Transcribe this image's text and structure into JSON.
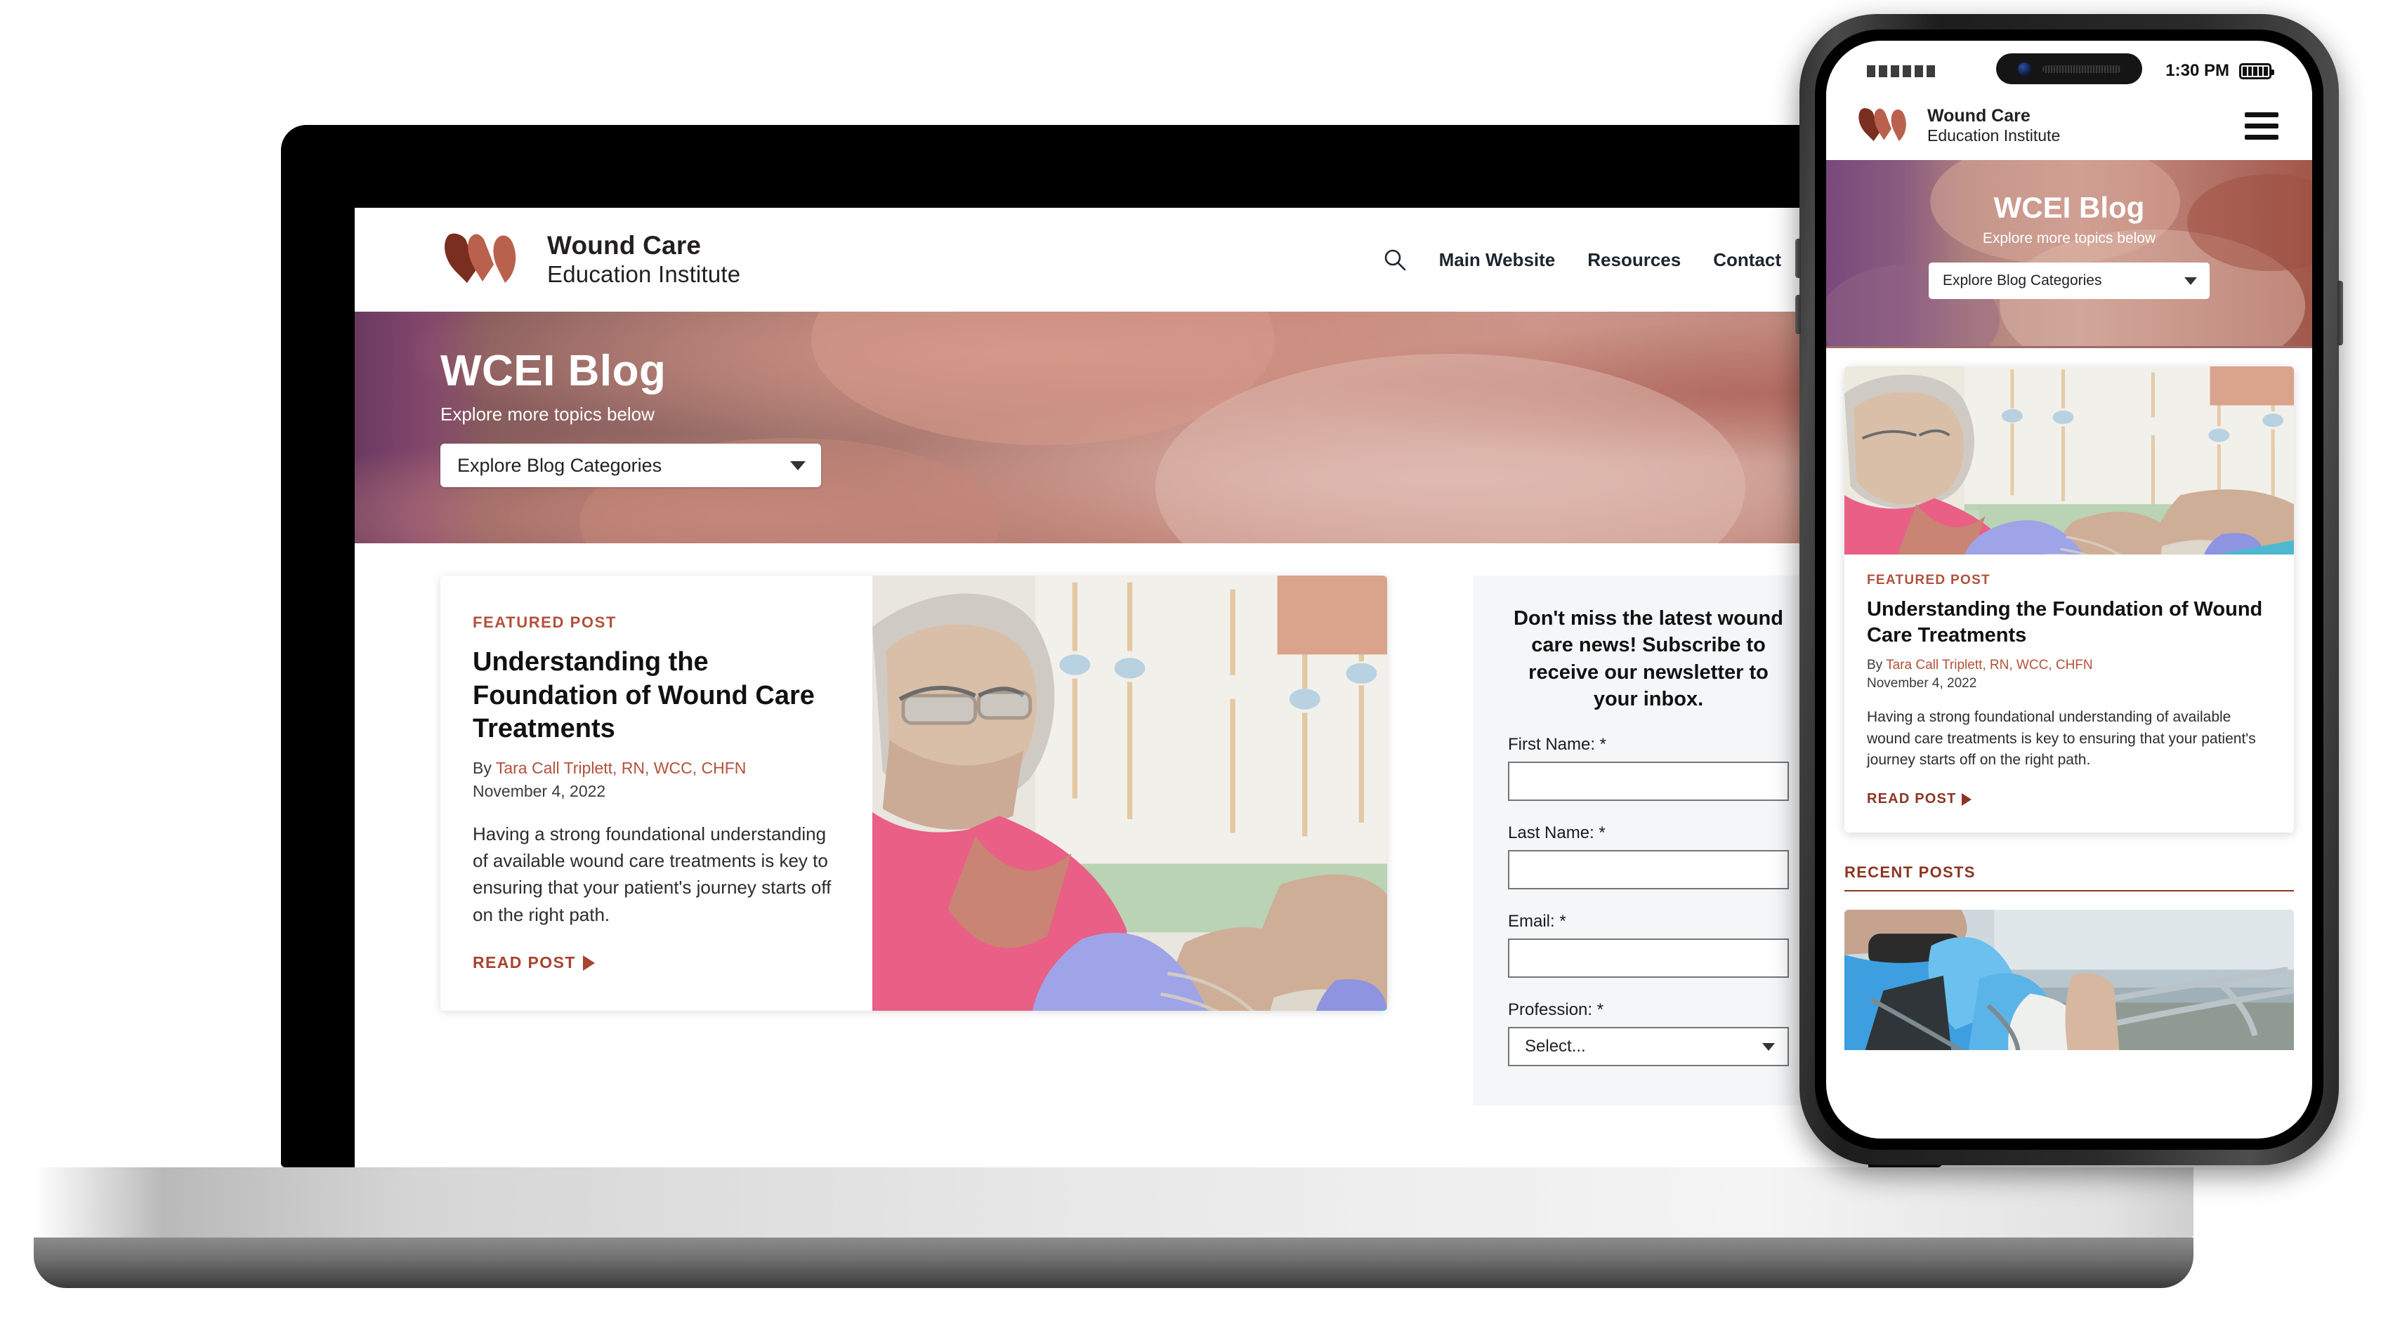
{
  "brand": {
    "logo_line1": "Wound Care",
    "logo_line2": "Education Institute",
    "accent": "#b2513c",
    "accent_dark": "#8c3523",
    "logo_dark": "#7a2e20",
    "logo_light": "#b9614d"
  },
  "desktop": {
    "nav": {
      "search_icon": "search-icon",
      "links": [
        {
          "label": "Main Website"
        },
        {
          "label": "Resources"
        },
        {
          "label": "Contact"
        }
      ]
    },
    "hero": {
      "title": "WCEI Blog",
      "subtitle": "Explore more topics below",
      "category_select": {
        "value": "Explore Blog Categories",
        "icon": "chevron-down-icon"
      }
    },
    "featured": {
      "eyebrow": "FEATURED POST",
      "title": "Understanding the Foundation of Wound Care Treatments",
      "by_prefix": "By ",
      "author": "Tara Call Triplett, RN, WCC, CHFN",
      "date": "November 4, 2022",
      "excerpt": "Having a strong foundational understanding of available wound care treatments is key to ensuring that your patient's journey starts off on the right path.",
      "read_label": "READ POST",
      "read_icon": "play-triangle-icon",
      "image_alt": "nurse-bandaging-patient-arm-photo"
    },
    "newsletter": {
      "heading": "Don't miss the latest wound care news! Subscribe to receive our newsletter to your inbox.",
      "fields": [
        {
          "label": "First Name: *",
          "value": "",
          "type": "text"
        },
        {
          "label": "Last Name: *",
          "value": "",
          "type": "text"
        },
        {
          "label": "Email: *",
          "value": "",
          "type": "text"
        }
      ],
      "profession": {
        "label": "Profession: *",
        "value": "Select...",
        "icon": "chevron-down-icon"
      }
    }
  },
  "phone": {
    "status": {
      "signal_icon": "signal-bars-icon",
      "time": "1:30 PM",
      "battery_icon": "battery-full-icon"
    },
    "header": {
      "menu_icon": "hamburger-menu-icon"
    },
    "hero": {
      "title": "WCEI Blog",
      "subtitle": "Explore more topics below",
      "category_select": {
        "value": "Explore Blog Categories",
        "icon": "chevron-down-icon"
      }
    },
    "featured": {
      "eyebrow": "FEATURED POST",
      "title": "Understanding the Foundation of Wound Care Treatments",
      "by_prefix": "By ",
      "author": "Tara Call Triplett, RN, WCC, CHFN",
      "date": "November 4, 2022",
      "excerpt": "Having a strong foundational understanding of available wound care treatments is key to ensuring that your patient's journey starts off on the right path.",
      "read_label": "READ POST",
      "read_icon": "play-triangle-icon",
      "image_alt": "nurse-bandaging-patient-arm-photo"
    },
    "recent": {
      "heading": "RECENT POSTS",
      "first_image_alt": "patient-in-wheelchair-bandaged-knee-photo"
    }
  }
}
